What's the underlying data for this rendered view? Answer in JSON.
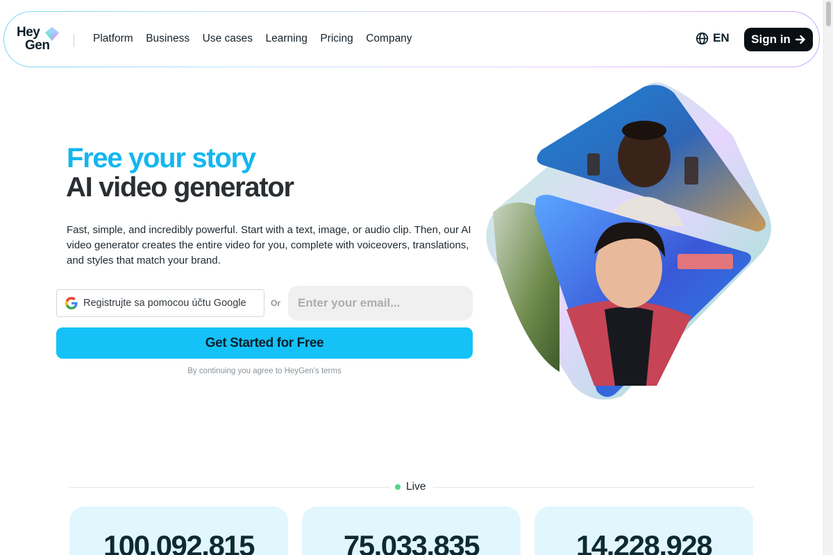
{
  "nav": {
    "logo_line1": "Hey",
    "logo_line2": "Gen",
    "links": [
      "Platform",
      "Business",
      "Use cases",
      "Learning",
      "Pricing",
      "Company"
    ],
    "language": "EN",
    "signin_label": "Sign in"
  },
  "hero": {
    "title_line1": "Free your story",
    "title_line2": "AI video generator",
    "description": "Fast, simple, and incredibly powerful. Start with a text, image, or audio clip. Then, our AI video generator creates the entire video for you, complete with voiceovers, translations, and styles that match your brand.",
    "google_button_label": "Registrujte sa pomocou účtu Google",
    "or_label": "Or",
    "email_placeholder": "Enter your email...",
    "cta_label": "Get Started for Free",
    "terms_text": "By continuing you agree to HeyGen's terms"
  },
  "live": {
    "label": "Live",
    "stats": [
      "100,092,815",
      "75,033,835",
      "14,228,928"
    ]
  },
  "colors": {
    "accent": "#14c2f7",
    "title_accent": "#12b6f0",
    "dark": "#0a0f14",
    "stat_bg": "#e2f6fd",
    "live_dot": "#54d68a"
  },
  "icons": [
    "heygen-logo-icon",
    "globe-icon",
    "arrow-right-icon",
    "google-icon"
  ]
}
